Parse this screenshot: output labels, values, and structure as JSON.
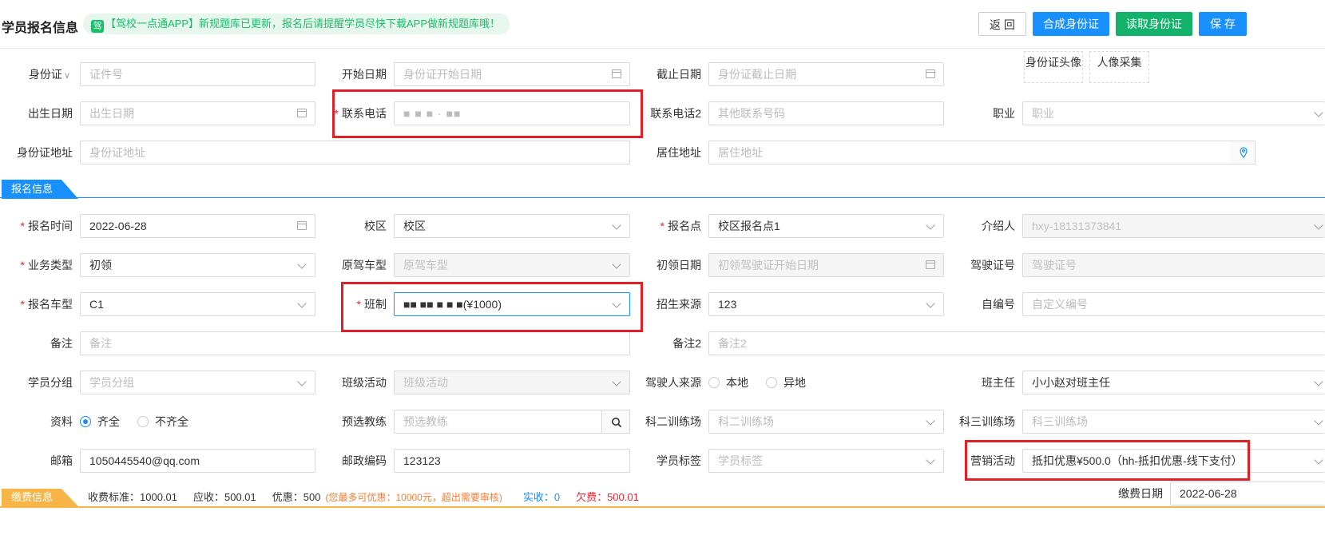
{
  "header": {
    "title": "学员报名信息",
    "notice_icon": "驾",
    "notice": "【驾校一点通APP】新规题库已更新，报名后请提醒学员尽快下载APP做新规题库哦！",
    "buttons": {
      "back": "返 回",
      "compose_id": "合成身份证",
      "read_id": "读取身份证",
      "save": "保 存"
    }
  },
  "id_section": {
    "id_type": "身份证",
    "id_number_ph": "证件号",
    "start_date_label": "开始日期",
    "start_date_ph": "身份证开始日期",
    "end_date_label": "截止日期",
    "end_date_ph": "身份证截止日期",
    "id_photo": "身份证头像",
    "portrait": "人像采集",
    "birth_label": "出生日期",
    "birth_ph": "出生日期",
    "phone_label": "联系电话",
    "phone_value": "■ ■ ■ ·  ■■",
    "phone2_label": "联系电话2",
    "phone2_ph": "其他联系号码",
    "job_label": "职业",
    "job_ph": "职业",
    "address_label": "身份证地址",
    "address_ph": "身份证地址",
    "residence_label": "居住地址",
    "residence_ph": "居住地址"
  },
  "registration": {
    "section_title": "报名信息",
    "time_label": "报名时间",
    "time_value": "2022-06-28",
    "campus_label": "校区",
    "campus_value": "校区",
    "point_label": "报名点",
    "point_value": "校区报名点1",
    "referrer_label": "介绍人",
    "referrer_value": "hxy-18131373841",
    "biz_label": "业务类型",
    "biz_value": "初领",
    "orig_car_label": "原驾车型",
    "orig_car_ph": "原驾车型",
    "first_date_label": "初领日期",
    "first_date_ph": "初领驾驶证开始日期",
    "license_label": "驾驶证号",
    "license_ph": "驾驶证号",
    "car_type_label": "报名车型",
    "car_type_value": "C1",
    "class_label": "班制",
    "class_value": "■■ ■■ ■  ■ ■(¥1000)",
    "source_label": "招生来源",
    "source_value": "123",
    "custom_no_label": "自编号",
    "custom_no_ph": "自定义编号",
    "remark_label": "备注",
    "remark_ph": "备注",
    "remark2_label": "备注2",
    "remark2_ph": "备注2",
    "group_label": "学员分组",
    "group_ph": "学员分组",
    "activity_label": "班级活动",
    "activity_ph": "班级活动",
    "driver_origin_label": "驾驶人来源",
    "driver_origin_local": "本地",
    "driver_origin_other": "异地",
    "head_teacher_label": "班主任",
    "head_teacher_value": "小小赵对班主任",
    "material_label": "资料",
    "material_full": "齐全",
    "material_partial": "不齐全",
    "coach_label": "预选教练",
    "coach_ph": "预选教练",
    "k2_label": "科二训练场",
    "k2_ph": "科二训练场",
    "k3_label": "科三训练场",
    "k3_ph": "科三训练场",
    "email_label": "邮箱",
    "email_value": "1050445540@qq.com",
    "postcode_label": "邮政编码",
    "postcode_value": "123123",
    "tag_label": "学员标签",
    "tag_ph": "学员标签",
    "marketing_label": "营销活动",
    "marketing_value": "抵扣优惠¥500.0（hh-抵扣优惠-线下支付）"
  },
  "payment": {
    "section_title": "缴费信息",
    "standard": "收费标准：1000.01",
    "due": "应收：500.01",
    "discount": "优惠：500",
    "discount_note": "(您最多可优惠：10000元，超出需要审核)",
    "received": "实收：0",
    "owed": "欠费：500.01",
    "date_label": "缴费日期",
    "date_value": "2022-06-28"
  },
  "colors": {
    "primary": "#1890ff",
    "green": "#13b26b",
    "required": "#f5222d",
    "highlight_box": "#e01f26",
    "payment_tab": "#f7b548"
  }
}
